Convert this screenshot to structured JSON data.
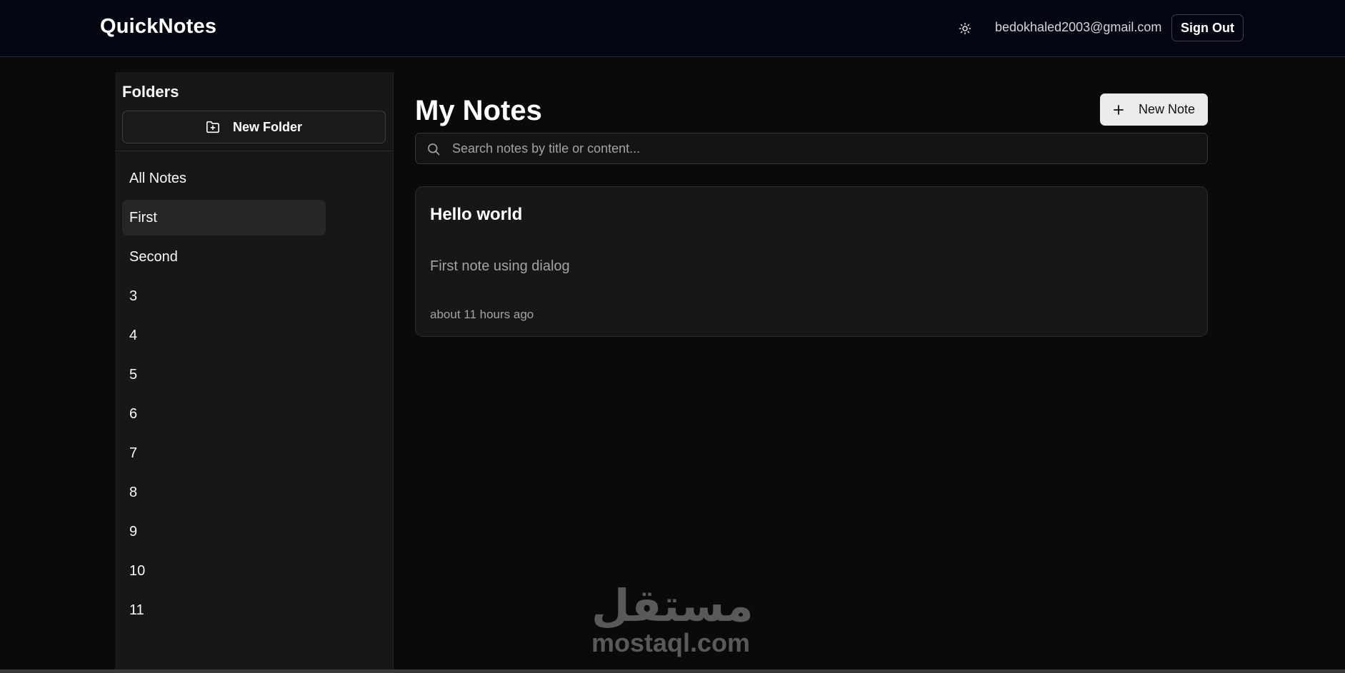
{
  "app": {
    "logo": "QuickNotes"
  },
  "header": {
    "theme_icon": "sun-icon",
    "user_email": "bedokhaled2003@gmail.com",
    "sign_out_label": "Sign Out"
  },
  "sidebar": {
    "title": "Folders",
    "new_folder_label": "New Folder",
    "new_folder_icon": "folder-plus-icon",
    "active_folder": "First",
    "folders": [
      "All Notes",
      "First",
      "Second",
      "3",
      "4",
      "5",
      "6",
      "7",
      "8",
      "9",
      "10",
      "11"
    ]
  },
  "main": {
    "title": "My Notes",
    "new_note_label": "New Note",
    "new_note_icon": "plus-icon",
    "search": {
      "placeholder": "Search notes by title or content...",
      "value": "",
      "icon": "search-icon"
    },
    "notes": [
      {
        "title": "Hello world",
        "content": "First note using dialog",
        "time": "about 11 hours ago"
      }
    ]
  },
  "watermark": {
    "arabic": "مستقل",
    "latin": "mostaql.com"
  },
  "colors": {
    "header_bg": "#030712",
    "page_bg": "#0a0a0a",
    "sidebar_bg": "#171717",
    "active_item_bg": "#262626",
    "primary_button_bg": "#ebebeb",
    "muted_text": "#a3a3a3"
  }
}
